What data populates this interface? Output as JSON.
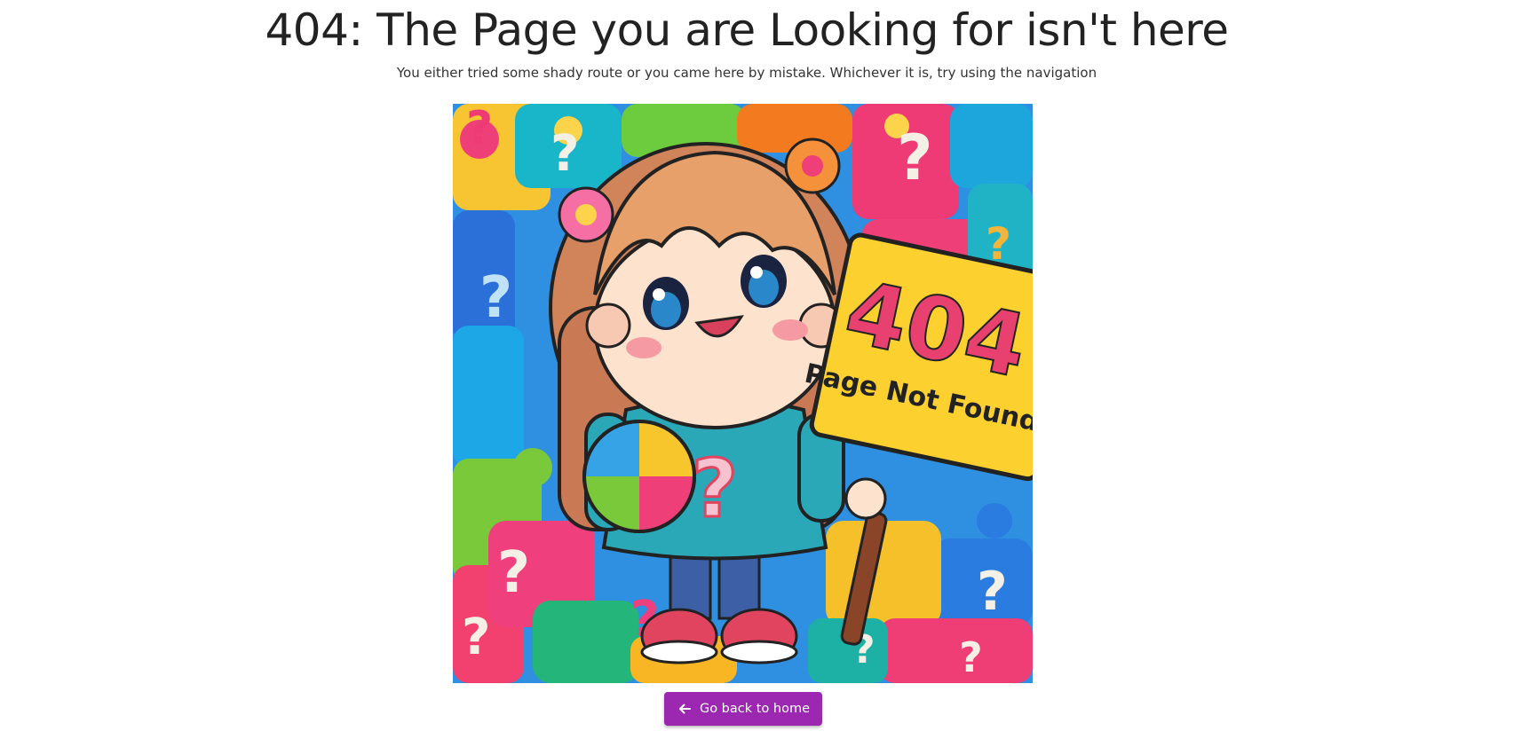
{
  "page": {
    "title": "404: The Page you are Looking for isn't here",
    "subtitle": "You either tried some shady route or you came here by mistake. Whichever it is, try using the navigation"
  },
  "illustration": {
    "sign_number": "404",
    "sign_text": "Page Not Found"
  },
  "home_button": {
    "label": "Go back to home",
    "icon": "arrow-left-icon",
    "color": "#9c27b0"
  }
}
